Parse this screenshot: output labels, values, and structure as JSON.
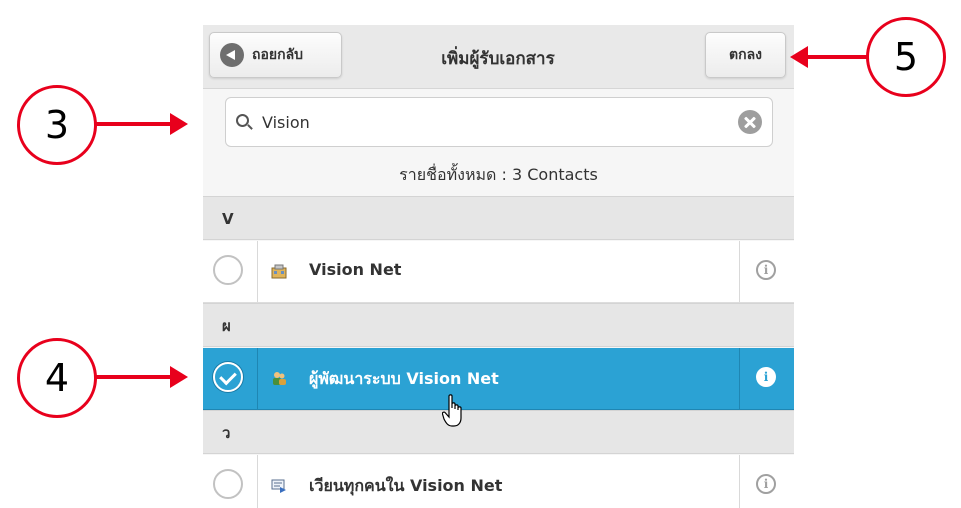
{
  "header": {
    "back_label": "ถอยกลับ",
    "title": "เพิ่มผู้รับเอกสาร",
    "ok_label": "ตกลง"
  },
  "search": {
    "value": "Vision"
  },
  "summary": {
    "count_text": "รายชื่อทั้งหมด : 3 Contacts"
  },
  "groups": [
    {
      "letter": "V",
      "items": [
        {
          "name": "Vision Net",
          "icon": "organization-icon",
          "selected": false
        }
      ]
    },
    {
      "letter": "ผ",
      "items": [
        {
          "name": "ผู้พัฒนาระบบ Vision Net",
          "icon": "person-group-icon",
          "selected": true
        }
      ]
    },
    {
      "letter": "ว",
      "items": [
        {
          "name": "เวียนทุกคนใน Vision Net",
          "icon": "broadcast-icon",
          "selected": false
        }
      ]
    }
  ],
  "annotations": {
    "step_search": "3",
    "step_select": "4",
    "step_confirm": "5"
  },
  "colors": {
    "selected_row": "#2ba2d4",
    "annotation": "#e8001c"
  }
}
